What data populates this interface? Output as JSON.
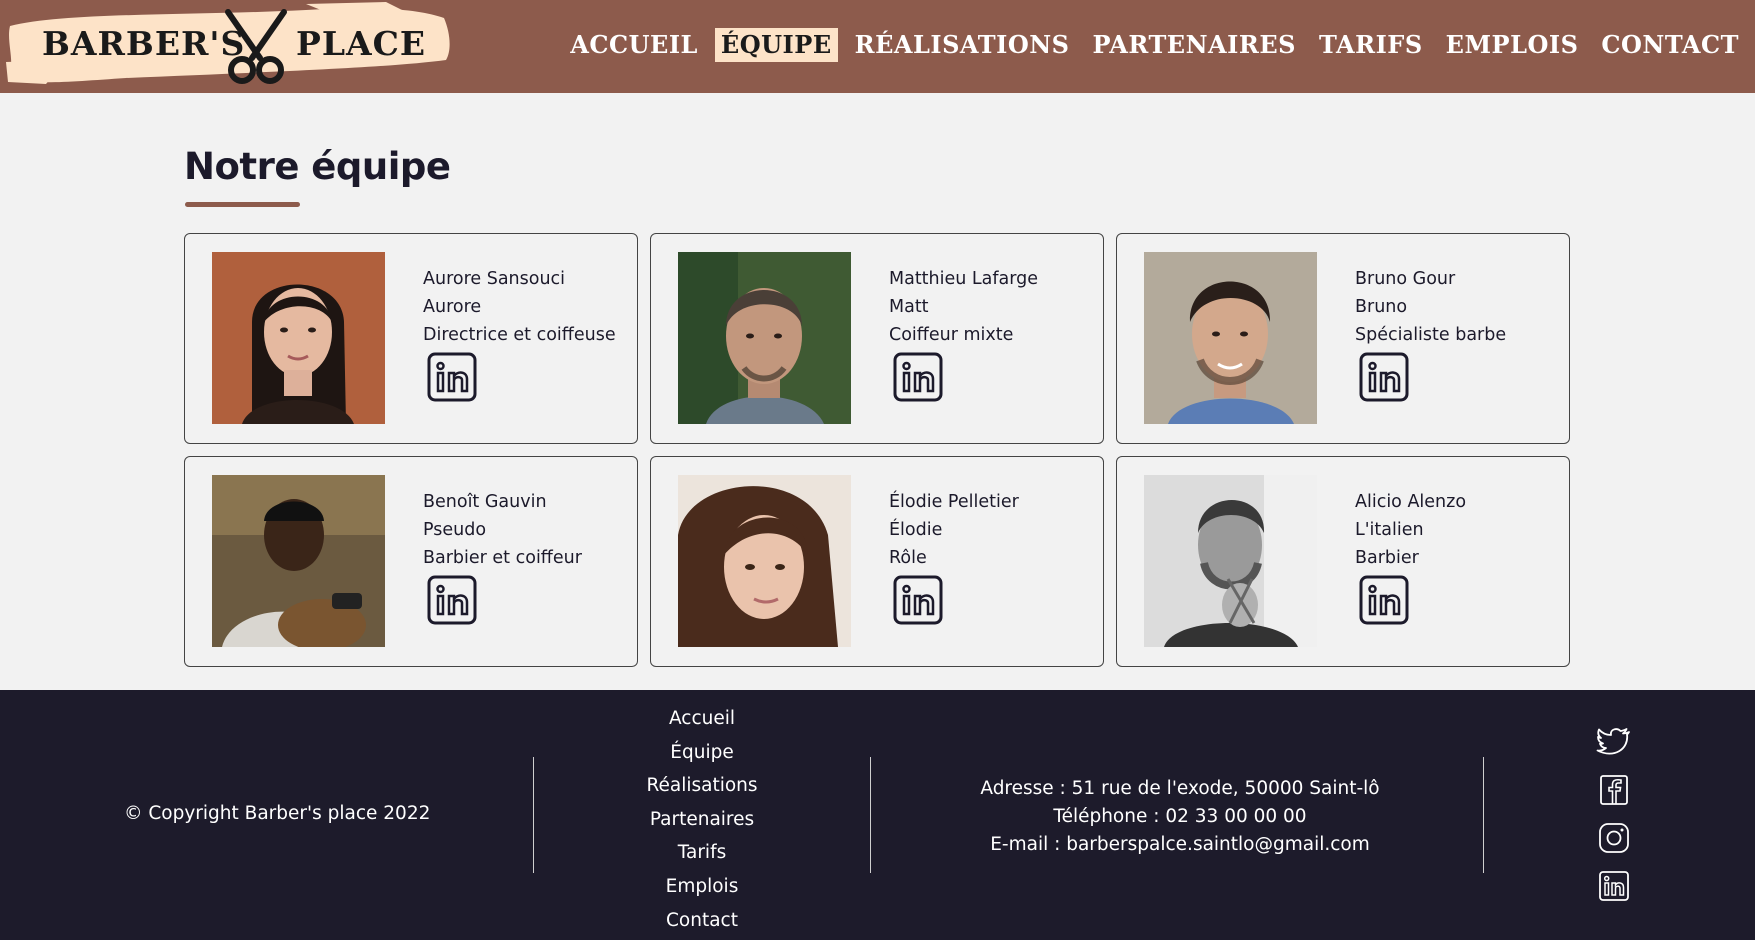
{
  "header": {
    "logo_left": "BARBER'S",
    "logo_right": "PLACE",
    "nav": [
      {
        "label": "ACCUEIL",
        "active": false
      },
      {
        "label": "ÉQUIPE",
        "active": true
      },
      {
        "label": "RÉALISATIONS",
        "active": false
      },
      {
        "label": "PARTENAIRES",
        "active": false
      },
      {
        "label": "TARIFS",
        "active": false
      },
      {
        "label": "EMPLOIS",
        "active": false
      },
      {
        "label": "CONTACT",
        "active": false
      }
    ]
  },
  "main": {
    "title": "Notre équipe",
    "team": [
      {
        "name": "Aurore Sansouci",
        "nickname": "Aurore",
        "role": "Directrice et coiffeuse",
        "photo": "portrait-woman-dark-hair"
      },
      {
        "name": "Matthieu Lafarge",
        "nickname": "Matt",
        "role": "Coiffeur mixte",
        "photo": "portrait-man-short-hair"
      },
      {
        "name": "Bruno Gour",
        "nickname": "Bruno",
        "role": "Spécialiste barbe",
        "photo": "portrait-man-beard"
      },
      {
        "name": "Benoît Gauvin",
        "nickname": "Pseudo",
        "role": "Barbier et coiffeur",
        "photo": "portrait-barber-working"
      },
      {
        "name": "Élodie Pelletier",
        "nickname": "Élodie",
        "role": "Rôle",
        "photo": "portrait-woman-brown-hair"
      },
      {
        "name": "Alicio Alenzo",
        "nickname": "L'italien",
        "role": "Barbier",
        "photo": "portrait-man-scissors-bw"
      }
    ]
  },
  "footer": {
    "copyright": "© Copyright Barber's place 2022",
    "links": [
      "Accueil",
      "Équipe",
      "Réalisations",
      "Partenaires",
      "Tarifs",
      "Emplois",
      "Contact"
    ],
    "address": "Adresse : 51 rue de l'exode, 50000 Saint-lô",
    "phone": "Téléphone : 02 33 00 00 00",
    "email": "E-mail : barberspalce.saintlo@gmail.com",
    "socials": [
      "twitter-icon",
      "facebook-icon",
      "instagram-icon",
      "linkedin-icon"
    ]
  },
  "colors": {
    "header_bg": "#8d5b4c",
    "accent": "#fde3c8",
    "page_bg": "#f2f2f2",
    "footer_bg": "#1d1b2b",
    "text_dark": "#1c1a2b"
  }
}
